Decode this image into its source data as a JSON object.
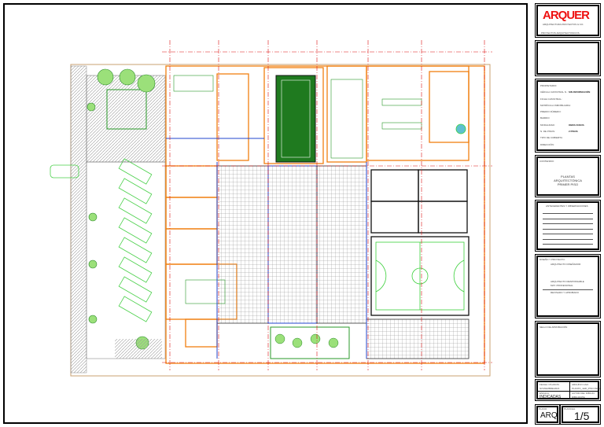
{
  "logo": {
    "brand": "ARQUER",
    "subtitle": "ARQUITECTURA PROYECTOS & CO.",
    "tagline": "PROYECTOS ARQUITECTONICOS"
  },
  "project_info": {
    "fields": [
      {
        "label": "PROPIETARIO:",
        "value": ""
      },
      {
        "label": "CÉDULA CATASTRAL N.:",
        "value": "SIN INFORMACIÓN"
      },
      {
        "label": "FICHA CATASTRAL:",
        "value": ""
      },
      {
        "label": "MATRÍCULA INMOBILIARIA:",
        "value": ""
      },
      {
        "label": "PREDIO NÚMERO:",
        "value": ""
      },
      {
        "label": "BARRIO:",
        "value": ""
      },
      {
        "label": "MODALIDAD:",
        "value": "OBRA NUEVA"
      },
      {
        "label": "N. DE PISOS:",
        "value": "2 PISOS"
      },
      {
        "label": "TIPO DE CUBIERTA:",
        "value": ""
      },
      {
        "label": "DIRECCIÓN:",
        "value": ""
      }
    ]
  },
  "content": {
    "header": "CONTENIDO:",
    "title": "PLANTAS ARQUITECTÓNICA PRIMER PISO"
  },
  "notes": {
    "header": "ANTECEDENTES Y OBSERVACIONES"
  },
  "design": {
    "header": "DISEÑO Y PROYECTO:",
    "role": "ARQUITECTO DISEÑADOR",
    "name": "ARQUITECTO RESPONSABLE",
    "reg": "MAT. PROFESIONAL",
    "signature_line": "REVISADO Y APROBADO"
  },
  "approval": {
    "header": "SELLO DE APROBACIÓN"
  },
  "meta": {
    "date_label": "FECHA / PLANOS:",
    "date_value": "NOVIEMBRE/2021",
    "file_label": "ARCHIVO CAD:",
    "file_value": "PLANTA_1ER_PISO.DWG",
    "scale_label": "ESCALA:",
    "scale_value": "INDICADAS",
    "author_label": "AUTOR DEL DIBUJO:",
    "author_value": "DIBUJANTE"
  },
  "sheet": {
    "type_label": "PLANO:",
    "type": "ARQ",
    "number_label": "PLANCHA:",
    "number": "1/5"
  }
}
